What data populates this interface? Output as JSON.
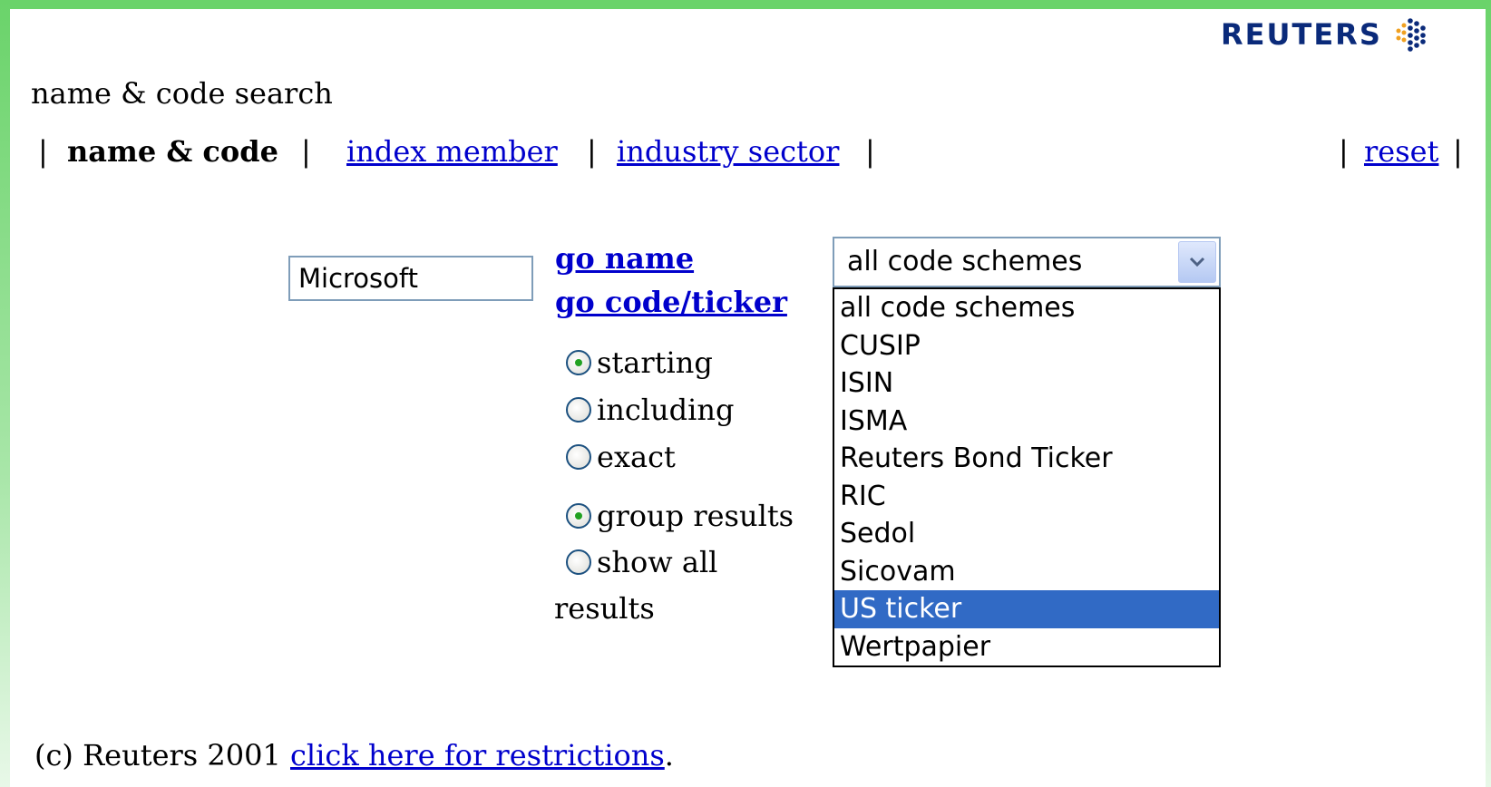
{
  "brand": {
    "name": "REUTERS"
  },
  "page": {
    "title": "name & code search"
  },
  "nav": {
    "current": "name & code",
    "index_member": "index member",
    "industry_sector": "industry sector",
    "reset": "reset",
    "separator": "|"
  },
  "search": {
    "value": "Microsoft",
    "go_name": "go name",
    "go_code": "go code/ticker"
  },
  "match_options": [
    {
      "label": "starting",
      "selected": true
    },
    {
      "label": "including",
      "selected": false
    },
    {
      "label": "exact",
      "selected": false
    }
  ],
  "grouping_options": [
    {
      "label": "group results",
      "selected": true
    },
    {
      "label": "show all",
      "selected": false
    }
  ],
  "grouping_wrap": "results",
  "code_scheme": {
    "selected": "all code schemes",
    "options": [
      "all code schemes",
      "CUSIP",
      "ISIN",
      "ISMA",
      "Reuters Bond Ticker",
      "RIC",
      "Sedol",
      "Sicovam",
      "US ticker",
      "Wertpapier"
    ],
    "highlighted": "US ticker"
  },
  "footer": {
    "copyright": "(c) Reuters 2001",
    "link": "click here for restrictions",
    "period": "."
  },
  "colors": {
    "frame": "#6ad36a",
    "link": "#0000cc",
    "brand": "#0a2a7a",
    "highlight": "#316ac5"
  }
}
